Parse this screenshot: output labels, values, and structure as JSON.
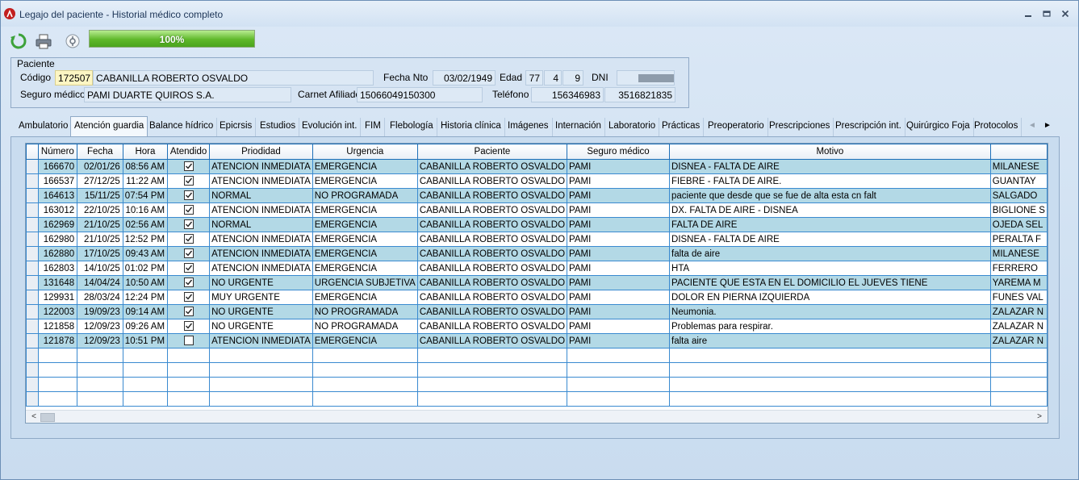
{
  "window": {
    "title": "Legajo del paciente - Historial médico completo",
    "controls": [
      "minimize-icon",
      "maximize-icon",
      "close-icon"
    ]
  },
  "toolbar": {
    "refresh_icon": "refresh-icon",
    "print_icon": "printer-icon",
    "aux_icon": "medical-icon",
    "progress_label": "100%",
    "progress_value": 1.0
  },
  "patient": {
    "legend": "Paciente",
    "codigo_label": "Código",
    "codigo": "172507",
    "nombre": "CABANILLA ROBERTO OSVALDO",
    "fecha_nto_label": "Fecha Nto",
    "fecha_nto": "03/02/1949",
    "edad_label": "Edad",
    "edad_years": "77",
    "edad_months": "4",
    "edad_days": "9",
    "dni_label": "DNI",
    "dni": "",
    "seguro_label": "Seguro médico",
    "seguro": "PAMI DUARTE QUIROS S.A.",
    "carnet_label": "Carnet Afiliado",
    "carnet": "15066049150300",
    "telefono_label": "Teléfono",
    "telefono1": "156346983",
    "telefono2": "3516821835"
  },
  "tabs": [
    "Ambulatorio",
    "Atención guardia",
    "Balance hídrico",
    "Epicrsis",
    "Estudios",
    "Evolución int.",
    "FIM",
    "Flebología",
    "Historia clínica",
    "Imágenes",
    "Internación",
    "Laboratorio",
    "Prácticas",
    "Preoperatorio",
    "Prescripciones",
    "Prescripción int.",
    "Quirúrgico Foja",
    "Protocolos"
  ],
  "active_tab": "Atención guardia",
  "grid": {
    "columns": [
      "Número",
      "Fecha",
      "Hora",
      "Atendido",
      "Priodidad",
      "Urgencia",
      "Paciente",
      "Seguro médico",
      "Motivo",
      ""
    ],
    "rows": [
      {
        "numero": "166670",
        "fecha": "02/01/26",
        "hora": "08:56 AM",
        "atendido": true,
        "prioridad": "ATENCION INMEDIATA",
        "urgencia": "EMERGENCIA",
        "paciente": "CABANILLA ROBERTO OSVALDO",
        "seguro": "PAMI",
        "motivo": "DISNEA - FALTA DE AIRE",
        "extra": "MILANESE"
      },
      {
        "numero": "166537",
        "fecha": "27/12/25",
        "hora": "11:22 AM",
        "atendido": true,
        "prioridad": "ATENCION INMEDIATA",
        "urgencia": "EMERGENCIA",
        "paciente": "CABANILLA ROBERTO OSVALDO",
        "seguro": "PAMI",
        "motivo": "FIEBRE - FALTA DE AIRE.",
        "extra": "GUANTAY"
      },
      {
        "numero": "164613",
        "fecha": "15/11/25",
        "hora": "07:54 PM",
        "atendido": true,
        "prioridad": "NORMAL",
        "urgencia": "NO PROGRAMADA",
        "paciente": "CABANILLA ROBERTO OSVALDO",
        "seguro": "PAMI",
        "motivo": "paciente que desde que se fue de alta esta cn falt",
        "extra": "SALGADO"
      },
      {
        "numero": "163012",
        "fecha": "22/10/25",
        "hora": "10:16 AM",
        "atendido": true,
        "prioridad": "ATENCION INMEDIATA",
        "urgencia": "EMERGENCIA",
        "paciente": "CABANILLA ROBERTO OSVALDO",
        "seguro": "PAMI",
        "motivo": "DX. FALTA DE AIRE - DISNEA",
        "extra": "BIGLIONE S"
      },
      {
        "numero": "162969",
        "fecha": "21/10/25",
        "hora": "02:56 AM",
        "atendido": true,
        "prioridad": "NORMAL",
        "urgencia": "EMERGENCIA",
        "paciente": "CABANILLA ROBERTO OSVALDO",
        "seguro": "PAMI",
        "motivo": "FALTA DE AIRE",
        "extra": "OJEDA SEL"
      },
      {
        "numero": "162980",
        "fecha": "21/10/25",
        "hora": "12:52 PM",
        "atendido": true,
        "prioridad": "ATENCION INMEDIATA",
        "urgencia": "EMERGENCIA",
        "paciente": "CABANILLA ROBERTO OSVALDO",
        "seguro": "PAMI",
        "motivo": "DISNEA - FALTA DE AIRE",
        "extra": "PERALTA F"
      },
      {
        "numero": "162880",
        "fecha": "17/10/25",
        "hora": "09:43 AM",
        "atendido": true,
        "prioridad": "ATENCION INMEDIATA",
        "urgencia": "EMERGENCIA",
        "paciente": "CABANILLA ROBERTO OSVALDO",
        "seguro": "PAMI",
        "motivo": "falta de aire",
        "extra": "MILANESE"
      },
      {
        "numero": "162803",
        "fecha": "14/10/25",
        "hora": "01:02 PM",
        "atendido": true,
        "prioridad": "ATENCION INMEDIATA",
        "urgencia": "EMERGENCIA",
        "paciente": "CABANILLA ROBERTO OSVALDO",
        "seguro": "PAMI",
        "motivo": "HTA",
        "extra": "FERRERO"
      },
      {
        "numero": "131648",
        "fecha": "14/04/24",
        "hora": "10:50 AM",
        "atendido": true,
        "prioridad": "NO URGENTE",
        "urgencia": "URGENCIA SUBJETIVA",
        "paciente": "CABANILLA ROBERTO OSVALDO",
        "seguro": "PAMI",
        "motivo": "PACIENTE QUE ESTA EN EL DOMICILIO EL JUEVES TIENE",
        "extra": "YAREMA M"
      },
      {
        "numero": "129931",
        "fecha": "28/03/24",
        "hora": "12:24 PM",
        "atendido": true,
        "prioridad": "MUY URGENTE",
        "urgencia": "EMERGENCIA",
        "paciente": "CABANILLA ROBERTO OSVALDO",
        "seguro": "PAMI",
        "motivo": "DOLOR EN PIERNA IZQUIERDA",
        "extra": "FUNES VAL"
      },
      {
        "numero": "122003",
        "fecha": "19/09/23",
        "hora": "09:14 AM",
        "atendido": true,
        "prioridad": "NO URGENTE",
        "urgencia": "NO PROGRAMADA",
        "paciente": "CABANILLA ROBERTO OSVALDO",
        "seguro": "PAMI",
        "motivo": "Neumonia.",
        "extra": "ZALAZAR N"
      },
      {
        "numero": "121858",
        "fecha": "12/09/23",
        "hora": "09:26 AM",
        "atendido": true,
        "prioridad": "NO URGENTE",
        "urgencia": "NO PROGRAMADA",
        "paciente": "CABANILLA ROBERTO OSVALDO",
        "seguro": "PAMI",
        "motivo": "Problemas para respirar.",
        "extra": "ZALAZAR N"
      },
      {
        "numero": "121878",
        "fecha": "12/09/23",
        "hora": "10:51 PM",
        "atendido": false,
        "prioridad": "ATENCION INMEDIATA",
        "urgencia": "EMERGENCIA",
        "paciente": "CABANILLA ROBERTO OSVALDO",
        "seguro": "PAMI",
        "motivo": "falta aire",
        "extra": "ZALAZAR N"
      }
    ],
    "blank_rows": 4
  },
  "colors": {
    "row_highlight": "#b3d9e6",
    "grid_line": "#3a8ad0",
    "progress_green": "#5fb82a"
  }
}
